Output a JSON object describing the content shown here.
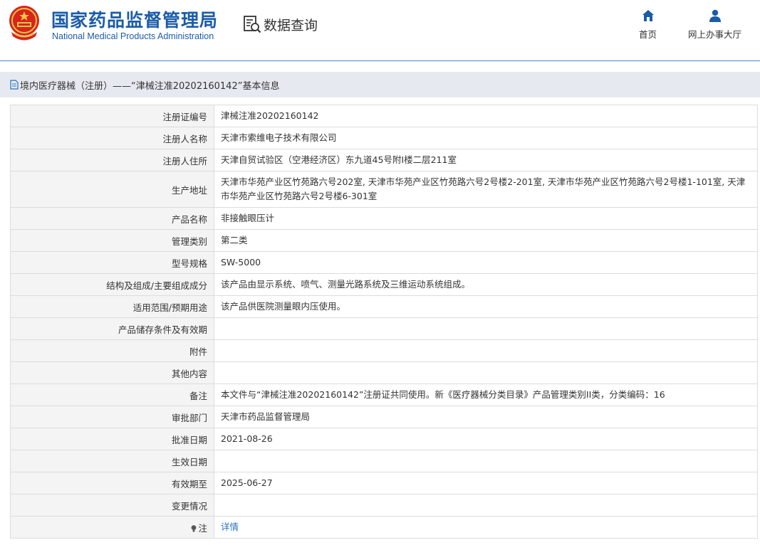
{
  "header": {
    "brand_cn": "国家药品监督管理局",
    "brand_en": "National Medical Products Administration",
    "query_label": "数据查询",
    "nav": [
      {
        "label": "首页",
        "icon": "home-icon"
      },
      {
        "label": "网上办事大厅",
        "icon": "user-icon"
      }
    ]
  },
  "page_title": "境内医疗器械（注册）——“津械注准20202160142”基本信息",
  "rows": [
    {
      "label": "注册证编号",
      "value": "津械注准20202160142"
    },
    {
      "label": "注册人名称",
      "value": "天津市索维电子技术有限公司"
    },
    {
      "label": "注册人住所",
      "value": "天津自贸试验区（空港经济区）东九道45号附I楼二层211室"
    },
    {
      "label": "生产地址",
      "value": "天津市华苑产业区竹苑路六号202室, 天津市华苑产业区竹苑路六号2号楼2-201室, 天津市华苑产业区竹苑路六号2号楼1-101室, 天津市华苑产业区竹苑路六号2号楼6-301室"
    },
    {
      "label": "产品名称",
      "value": "非接触眼压计"
    },
    {
      "label": "管理类别",
      "value": "第二类"
    },
    {
      "label": "型号规格",
      "value": "SW-5000"
    },
    {
      "label": "结构及组成/主要组成成分",
      "value": "该产品由显示系统、喷气、测量光路系统及三维运动系统组成。"
    },
    {
      "label": "适用范围/预期用途",
      "value": "该产品供医院测量眼内压使用。"
    },
    {
      "label": "产品储存条件及有效期",
      "value": ""
    },
    {
      "label": "附件",
      "value": ""
    },
    {
      "label": "其他内容",
      "value": ""
    },
    {
      "label": "备注",
      "value": "本文件与“津械注准20202160142”注册证共同使用。新《医疗器械分类目录》产品管理类别II类，分类编码：16"
    },
    {
      "label": "审批部门",
      "value": "天津市药品监督管理局"
    },
    {
      "label": "批准日期",
      "value": "2021-08-26"
    },
    {
      "label": "生效日期",
      "value": ""
    },
    {
      "label": "有效期至",
      "value": "2025-06-27"
    },
    {
      "label": "变更情况",
      "value": ""
    }
  ],
  "note_row": {
    "label": "注",
    "link": "详情",
    "icon": "lightbulb-icon"
  },
  "colors": {
    "brand_blue": "#1b5ca8",
    "link_blue": "#2a72c4",
    "title_bar_bg": "#e6eaf0",
    "label_bg": "#f4f4f4"
  }
}
